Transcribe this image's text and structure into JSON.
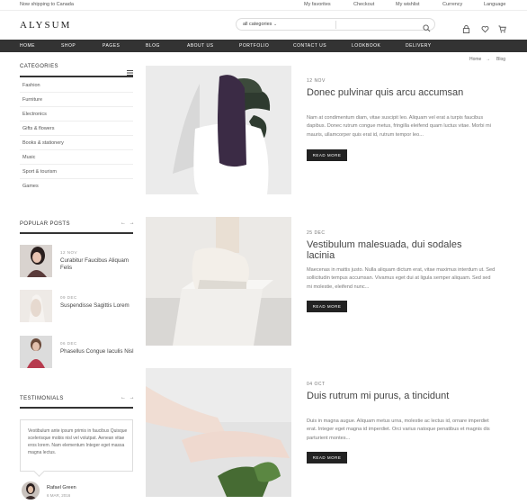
{
  "topbar": {
    "shipping": "Now shipping to Canada",
    "links": [
      "My favorites",
      "Checkout",
      "My wishlist",
      "Currency",
      "Language"
    ]
  },
  "header": {
    "logo": "ALYSUM",
    "search_category": "all categories"
  },
  "nav": [
    "HOME",
    "SHOP",
    "PAGES",
    "BLOG",
    "ABOUT US",
    "PORTFOLIO",
    "CONTACT US",
    "LOOKBOOK",
    "DELIVERY"
  ],
  "breadcrumb": {
    "home": "Home",
    "current": "Blog"
  },
  "sidebar": {
    "categories_title": "CATEGORIES",
    "categories": [
      "Fashion",
      "Furniture",
      "Electronics",
      "Gifts & flowers",
      "Books & stationery",
      "Music",
      "Sport & tourism",
      "Games"
    ],
    "popular_title": "POPULAR POSTS",
    "popular": [
      {
        "date": "12 NOV",
        "title": "Curabitur Faucibus Aliquam Felis"
      },
      {
        "date": "09 DEC",
        "title": "Suspendisse Sagittis Lorem"
      },
      {
        "date": "06 DEC",
        "title": "Phasellus Congue Iaculis Nisl"
      }
    ],
    "testimonials_title": "TESTIMONIALS",
    "testimonial": {
      "text": "Vestibulum ante ipsum primis in faucibus Quisque scelerisque mobis nisl vel volutpat. Aenean vitae eros lorem. Nam elementum Integer eget massa magna lectus.",
      "name": "Rafael Green",
      "date": "6 MAR, 2016"
    }
  },
  "posts": [
    {
      "date": "12 NOV",
      "title": "Donec pulvinar quis arcu accumsan",
      "excerpt": "Nam at condimentum diam, vitae suscipit leo. Aliquam vel erat a turpis faucibus dapibus. Donec rutrum congue metus, fringilla eleifend quam luctus vitae. Morbi mi mauris, ullamcorper quis erat id, rutrum tempor leo...",
      "button": "READ MORE"
    },
    {
      "date": "25 DEC",
      "title": "Vestibulum malesuada, dui sodales lacinia",
      "excerpt": "Maecenas in mattis justo. Nulla aliquam dictum erat, vitae maximus interdum ut. Sed sollicitudin tempus accumsan. Vivamus eget dui at ligula semper aliquam. Sed sed mi molestie, eleifend nunc...",
      "button": "READ MORE"
    },
    {
      "date": "04 OCT",
      "title": "Duis rutrum mi purus, a tincidunt",
      "excerpt": "Duis in magna augue. Aliquam metus urna, molestie ac lectus id, ornare imperdiet erat. Integer eget magna id imperdiet. Orci varius natoque penatibus et magnis dis parturient montes...",
      "button": "READ MORE"
    }
  ]
}
